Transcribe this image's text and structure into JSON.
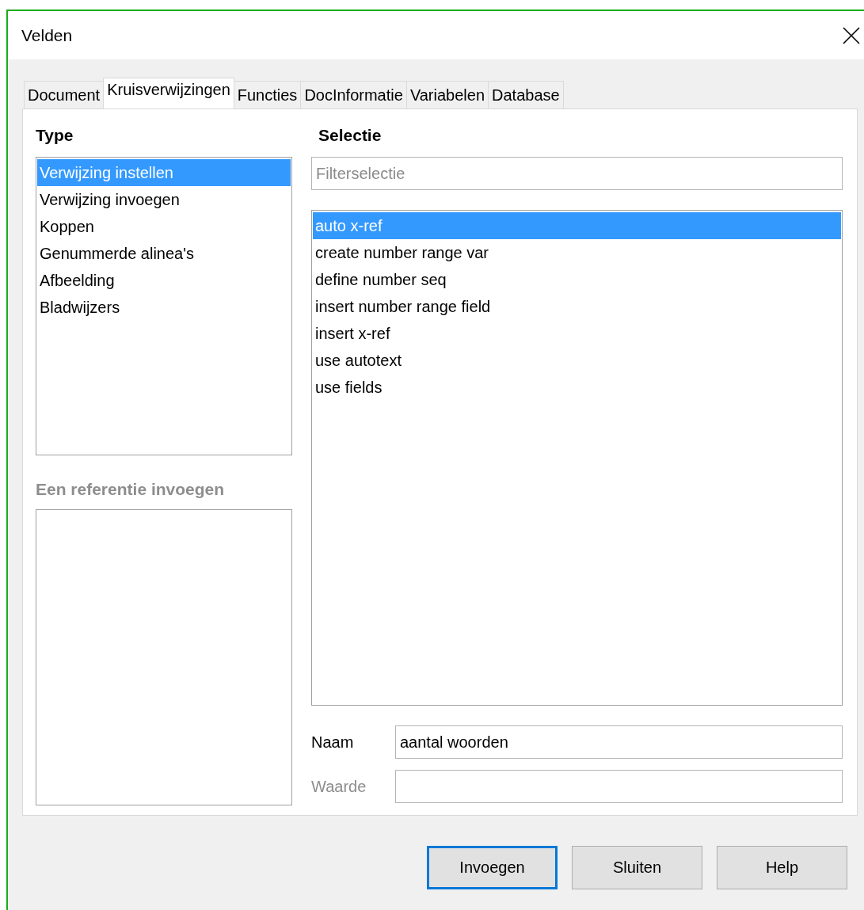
{
  "window": {
    "title": "Velden"
  },
  "tabs": [
    {
      "label": "Document",
      "selected": false
    },
    {
      "label": "Kruisverwijzingen",
      "selected": true
    },
    {
      "label": "Functies",
      "selected": false
    },
    {
      "label": "DocInformatie",
      "selected": false
    },
    {
      "label": "Variabelen",
      "selected": false
    },
    {
      "label": "Database",
      "selected": false
    }
  ],
  "type": {
    "heading": "Type",
    "items": [
      {
        "label": "Verwijzing instellen",
        "selected": true
      },
      {
        "label": "Verwijzing invoegen",
        "selected": false
      },
      {
        "label": "Koppen",
        "selected": false
      },
      {
        "label": "Genummerde alinea's",
        "selected": false
      },
      {
        "label": "Afbeelding",
        "selected": false
      },
      {
        "label": "Bladwijzers",
        "selected": false
      }
    ]
  },
  "reference": {
    "heading": "Een referentie invoegen",
    "disabled": true
  },
  "selection": {
    "heading": "Selectie",
    "filter": {
      "placeholder": "Filterselectie"
    },
    "items": [
      {
        "label": "auto x-ref",
        "selected": true
      },
      {
        "label": "create number range var",
        "selected": false
      },
      {
        "label": "define number seq",
        "selected": false
      },
      {
        "label": "insert number range field",
        "selected": false
      },
      {
        "label": "insert x-ref",
        "selected": false
      },
      {
        "label": "use autotext",
        "selected": false
      },
      {
        "label": "use fields",
        "selected": false
      }
    ]
  },
  "fields": [
    {
      "label": "Naam",
      "value": "aantal woorden",
      "disabled": false
    },
    {
      "label": "Waarde",
      "disabled": true
    }
  ],
  "buttons": [
    {
      "label": "Invoegen",
      "default": true
    },
    {
      "label": "Sluiten",
      "default": false
    },
    {
      "label": "Help",
      "default": false
    }
  ]
}
